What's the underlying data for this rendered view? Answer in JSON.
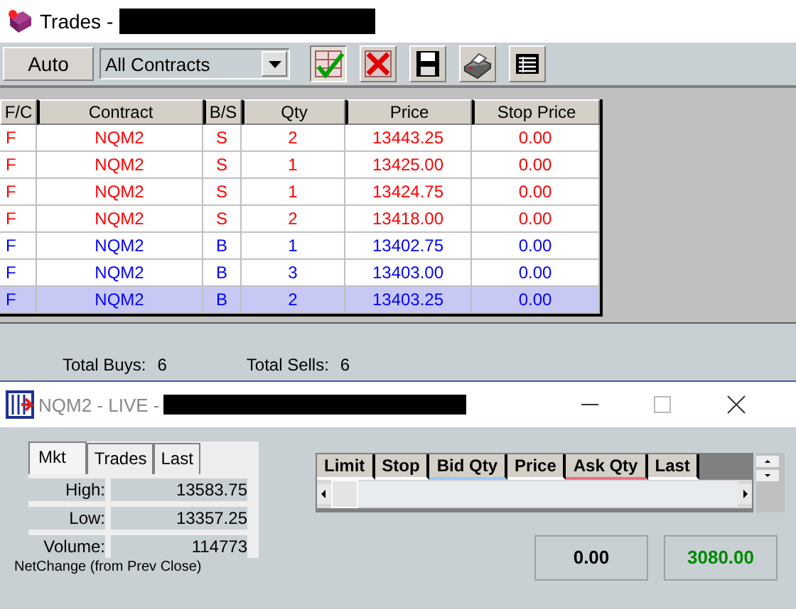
{
  "trades_window": {
    "title": "Trades -",
    "toolbar": {
      "auto_button": "Auto",
      "contract_filter": "All Contracts"
    },
    "table": {
      "columns": [
        "F/C",
        "Contract",
        "B/S",
        "Qty",
        "Price",
        "Stop Price"
      ],
      "rows": [
        {
          "cells": [
            "F",
            "NQM2",
            "S",
            "2",
            "13443.25",
            "0.00"
          ],
          "color": "#ff0000",
          "selected": false
        },
        {
          "cells": [
            "F",
            "NQM2",
            "S",
            "1",
            "13425.00",
            "0.00"
          ],
          "color": "#ff0000",
          "selected": false
        },
        {
          "cells": [
            "F",
            "NQM2",
            "S",
            "1",
            "13424.75",
            "0.00"
          ],
          "color": "#ff0000",
          "selected": false
        },
        {
          "cells": [
            "F",
            "NQM2",
            "S",
            "2",
            "13418.00",
            "0.00"
          ],
          "color": "#ff0000",
          "selected": false
        },
        {
          "cells": [
            "F",
            "NQM2",
            "B",
            "1",
            "13402.75",
            "0.00"
          ],
          "color": "#0000ff",
          "selected": false
        },
        {
          "cells": [
            "F",
            "NQM2",
            "B",
            "3",
            "13403.00",
            "0.00"
          ],
          "color": "#0000ff",
          "selected": false
        },
        {
          "cells": [
            "F",
            "NQM2",
            "B",
            "2",
            "13403.25",
            "0.00"
          ],
          "color": "#0000ff",
          "selected": true
        }
      ]
    },
    "totals": [
      {
        "label": "Total Buys:",
        "value": "6"
      },
      {
        "label": "Total Sells:",
        "value": "6"
      }
    ]
  },
  "market_window": {
    "title": "NQM2 - LIVE -",
    "tabs": [
      {
        "label": "Mkt",
        "selected": true
      },
      {
        "label": "Trades",
        "selected": false
      },
      {
        "label": "Last",
        "selected": false
      }
    ],
    "stats": [
      {
        "label": "High:",
        "value": "13583.75"
      },
      {
        "label": "Low:",
        "value": "13357.25"
      },
      {
        "label": "Volume:",
        "value": "114773"
      }
    ],
    "net_change_label": "NetChange (from Prev Close)",
    "ladder_columns": [
      {
        "label": "Limit"
      },
      {
        "label": "Stop"
      },
      {
        "label": "Bid Qty",
        "color": "#99c8f8"
      },
      {
        "label": "Price"
      },
      {
        "label": "Ask Qty",
        "color": "#f07080"
      },
      {
        "label": "Last"
      }
    ],
    "readouts": [
      {
        "value": "0.00",
        "color": "#000000"
      },
      {
        "value": "3080.00",
        "color": "#008800"
      }
    ]
  }
}
